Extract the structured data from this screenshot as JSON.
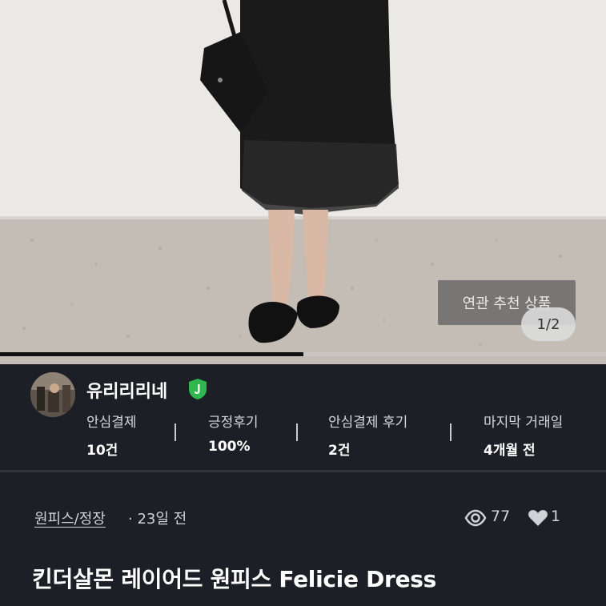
{
  "photo": {
    "related_tag": "연관 추천 상품",
    "page_indicator": "1/2",
    "progress_fraction": 0.5
  },
  "seller": {
    "name": "유리리리네",
    "verified_icon": "shield-check-icon",
    "verified_color": "#2fb84f",
    "stats": [
      {
        "label": "안심결제",
        "value": "10건"
      },
      {
        "label": "긍정후기",
        "value": "100%"
      },
      {
        "label": "안심결제 후기",
        "value": "2건"
      },
      {
        "label": "마지막 거래일",
        "value": "4개월 전"
      }
    ]
  },
  "meta": {
    "category": "원피스/정장",
    "time": "· 23일 전",
    "views": "77",
    "likes": "1"
  },
  "product": {
    "title": "킨더살몬 레이어드 원피스 Felicie Dress"
  },
  "colors": {
    "background": "#1c2026",
    "text": "#ffffff",
    "muted": "#d0d2d5"
  }
}
